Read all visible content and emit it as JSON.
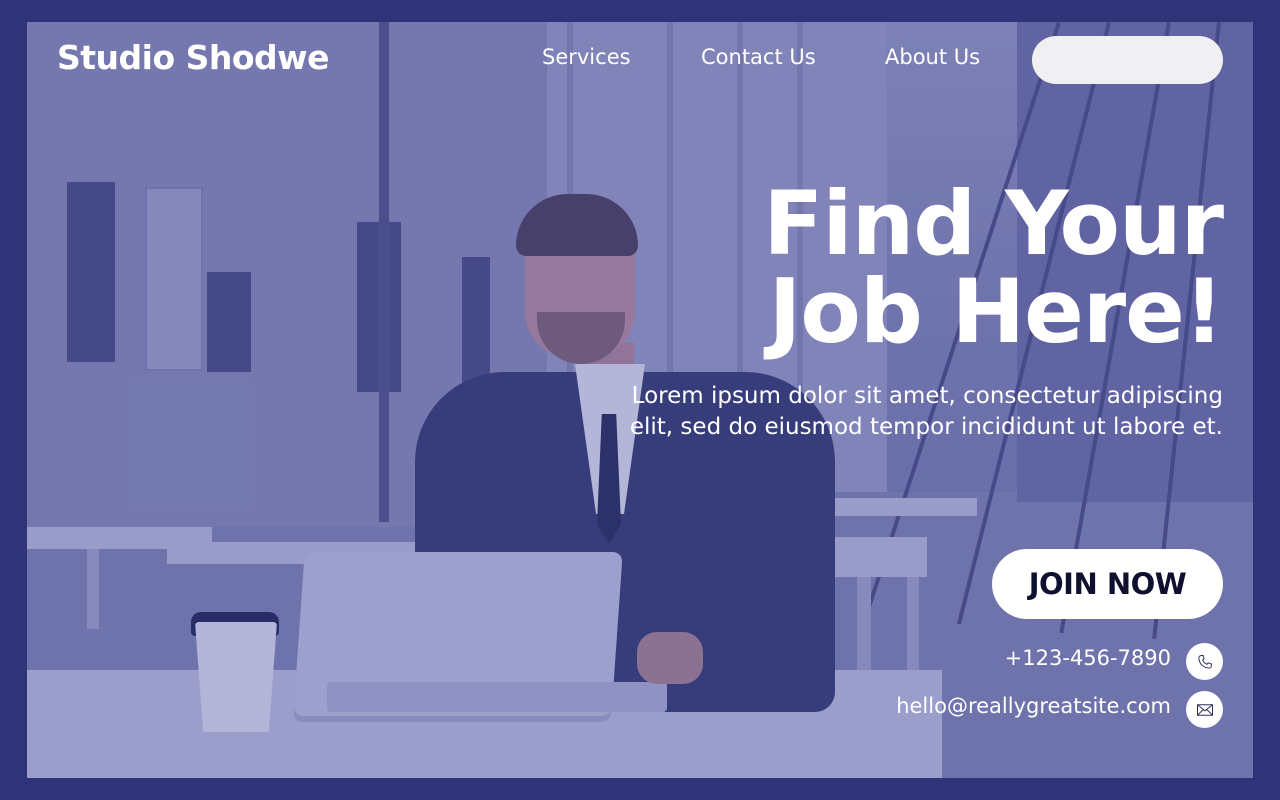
{
  "brand": {
    "name": "Studio Shodwe"
  },
  "nav": {
    "items": [
      {
        "label": "Services"
      },
      {
        "label": "Contact Us"
      },
      {
        "label": "About Us"
      }
    ],
    "pill_label": ""
  },
  "hero": {
    "title_line1": "Find Your",
    "title_line2": "Job Here!",
    "subtitle": "Lorem ipsum dolor sit amet, consectetur adipiscing elit, sed do eiusmod tempor incididunt ut labore et.",
    "cta_label": "JOIN NOW"
  },
  "contact": {
    "phone": "+123-456-7890",
    "email": "hello@reallygreatsite.com",
    "phone_icon": "phone-icon",
    "email_icon": "mail-icon"
  },
  "colors": {
    "frame_border": "#2f3478",
    "overlay_tint": "#3c4296",
    "text": "#ffffff",
    "button_bg": "#ffffff",
    "button_text": "#0f1030"
  }
}
